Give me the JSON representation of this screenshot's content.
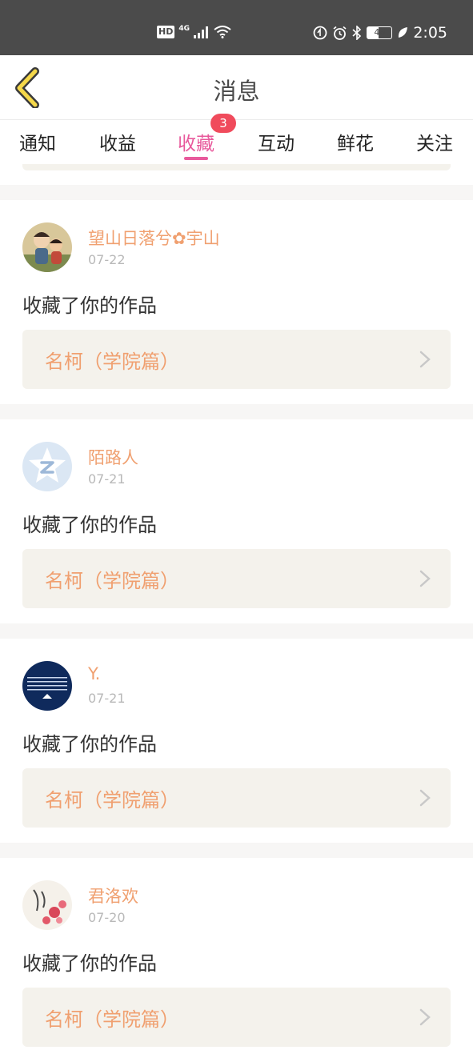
{
  "status_bar": {
    "hd": "HD",
    "network": "4G",
    "battery": "46",
    "time": "2:05"
  },
  "header": {
    "title": "消息",
    "back_icon": "chevron-left-icon"
  },
  "tabs": [
    {
      "label": "通知",
      "active": false
    },
    {
      "label": "收益",
      "active": false
    },
    {
      "label": "收藏",
      "active": true,
      "badge": "3"
    },
    {
      "label": "互动",
      "active": false
    },
    {
      "label": "鲜花",
      "active": false
    },
    {
      "label": "关注",
      "active": false
    }
  ],
  "notifications": [
    {
      "user": "望山日落兮✿宇山",
      "date": "07-22",
      "action": "收藏了你的作品",
      "work": "名柯（学院篇）"
    },
    {
      "user": "陌路人",
      "date": "07-21",
      "action": "收藏了你的作品",
      "work": "名柯（学院篇）"
    },
    {
      "user": "Y.",
      "date": "07-21",
      "action": "收藏了你的作品",
      "work": "名柯（学院篇）"
    },
    {
      "user": "君洛欢",
      "date": "07-20",
      "action": "收藏了你的作品",
      "work": "名柯（学院篇）"
    }
  ],
  "colors": {
    "accent": "#e85a9c",
    "username": "#f0a070",
    "badge": "#f04b5c",
    "back_icon": "#f5d84a"
  }
}
